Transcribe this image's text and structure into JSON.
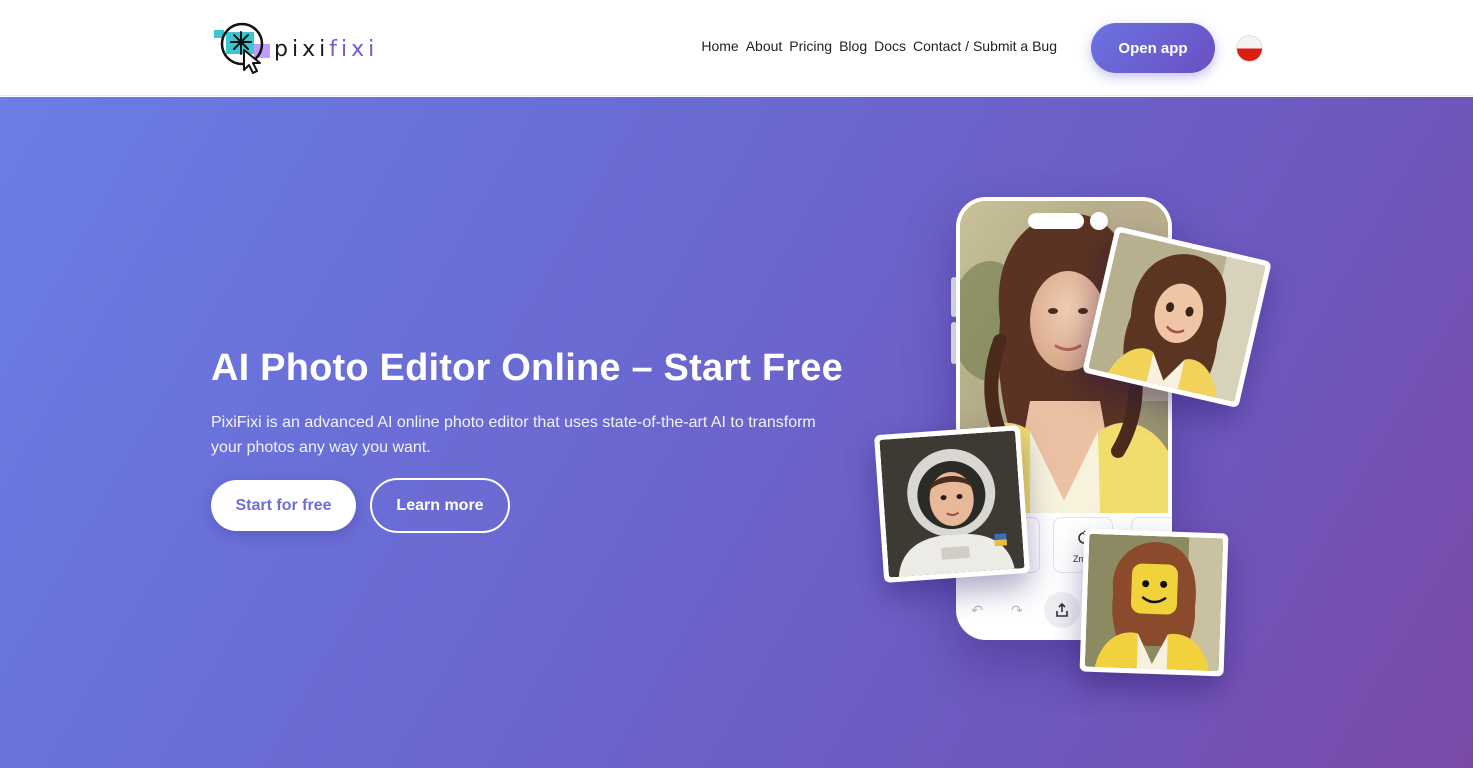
{
  "header": {
    "logo": {
      "word_part1": "pixi",
      "word_part2": "fixi",
      "icon": "cursor-sparkle-logo-icon"
    },
    "nav": [
      {
        "label": "Home"
      },
      {
        "label": "About"
      },
      {
        "label": "Pricing"
      },
      {
        "label": "Blog"
      },
      {
        "label": "Docs"
      },
      {
        "label": "Contact / Submit a Bug"
      }
    ],
    "open_app_label": "Open app",
    "language_flag": "poland-flag-icon"
  },
  "hero": {
    "title": "AI Photo Editor Online – Start Free",
    "subtitle": "PixiFixi is an advanced AI online photo editor that uses state-of-the-art AI to transform your photos any way you want.",
    "primary_button": "Start for free",
    "secondary_button": "Learn more"
  },
  "illustration": {
    "phone_tool_label": "Zmia",
    "phone_icons": [
      "undo-icon",
      "redo-icon",
      "share-icon"
    ],
    "cards": [
      "cartoon-portrait",
      "astronaut-portrait",
      "lego-portrait"
    ]
  },
  "colors": {
    "accent": "#6b6fd6",
    "hero_gradient_start": "#6b7de6",
    "hero_gradient_end": "#7a4aa8",
    "flag_red": "#dc1d14"
  }
}
